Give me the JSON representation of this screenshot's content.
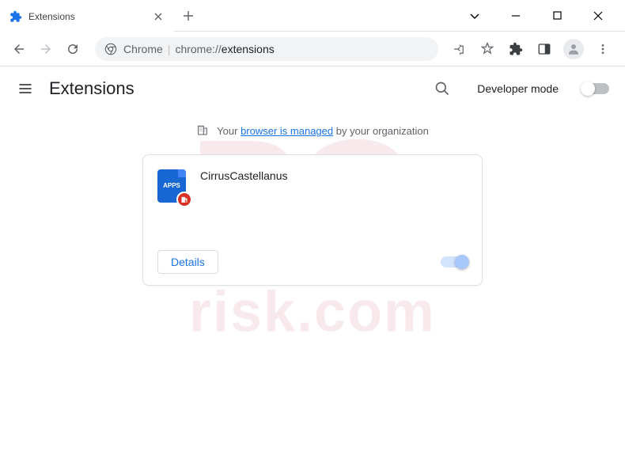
{
  "window": {
    "tab_title": "Extensions",
    "omnibox_prefix": "Chrome",
    "omnibox_path_prefix": "chrome://",
    "omnibox_path_bold": "extensions"
  },
  "page": {
    "title": "Extensions",
    "dev_mode_label": "Developer mode"
  },
  "banner": {
    "prefix": "Your",
    "link": "browser is managed",
    "suffix": "by your organization"
  },
  "extension": {
    "icon_text": "APPS",
    "name": "CirrusCastellanus",
    "details_label": "Details"
  },
  "watermark": {
    "main": "PC",
    "sub": "risk.com"
  }
}
